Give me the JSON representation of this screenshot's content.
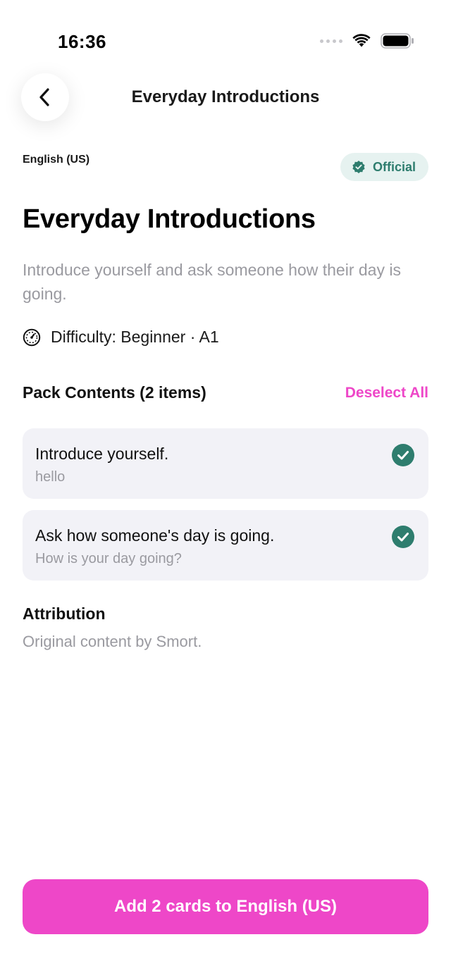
{
  "status_bar": {
    "time": "16:36",
    "icons": [
      "signal-dots-icon",
      "wifi-icon",
      "battery-icon"
    ]
  },
  "header": {
    "back_icon": "chevron-left-icon",
    "title": "Everyday Introductions"
  },
  "pack": {
    "language": "English (US)",
    "badge_label": "Official",
    "badge_icon": "verified-seal-icon",
    "title": "Everyday Introductions",
    "description": "Introduce yourself and ask someone how their day is going.",
    "difficulty_icon": "gauge-icon",
    "difficulty": "Difficulty: Beginner · A1"
  },
  "contents": {
    "heading": "Pack Contents (2 items)",
    "deselect_label": "Deselect All",
    "items": [
      {
        "title": "Introduce yourself.",
        "subtitle": "hello",
        "selected": true
      },
      {
        "title": "Ask how someone's day is going.",
        "subtitle": "How is your day going?",
        "selected": true
      }
    ]
  },
  "attribution": {
    "heading": "Attribution",
    "text": "Original content by Smort."
  },
  "footer": {
    "add_button_label": "Add 2 cards to English (US)"
  },
  "colors": {
    "accent": "#ee47c8",
    "teal": "#2e7d6e",
    "badge_bg": "#e6f2f0",
    "card_bg": "#f2f2f7",
    "muted_text": "#9a9aa0"
  }
}
